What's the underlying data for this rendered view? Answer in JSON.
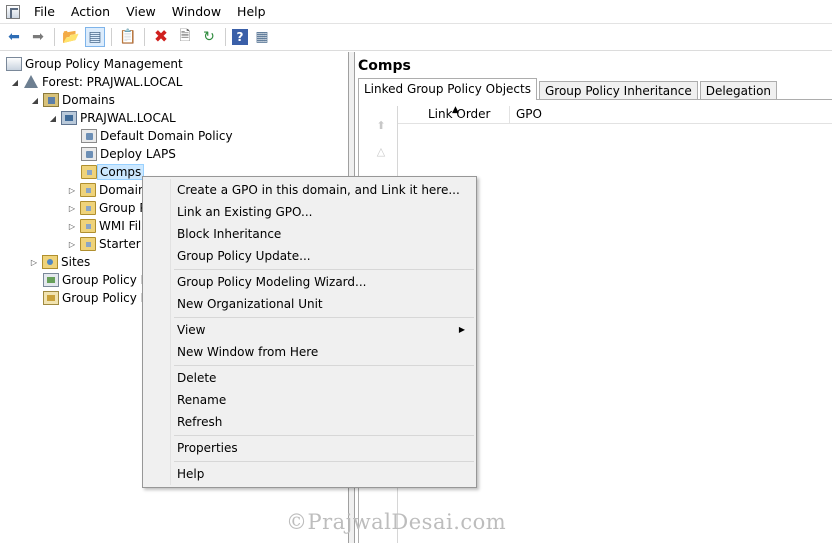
{
  "menubar": {
    "items": [
      {
        "label": "File"
      },
      {
        "label": "Action"
      },
      {
        "label": "View"
      },
      {
        "label": "Window"
      },
      {
        "label": "Help"
      }
    ]
  },
  "toolbar": {
    "buttons": [
      "back-arrow",
      "forward-arrow",
      "up-folder",
      "show-hide-tree",
      "properties",
      "delete",
      "export-list",
      "refresh",
      "help",
      "show-hide-action-pane"
    ]
  },
  "tree": {
    "root": "Group Policy Management",
    "forest": "Forest: PRAJWAL.LOCAL",
    "domains": "Domains",
    "domain": "PRAJWAL.LOCAL",
    "children": [
      {
        "label": "Default Domain Policy"
      },
      {
        "label": "Deploy LAPS"
      },
      {
        "label": "Comps"
      },
      {
        "label": "Domain"
      },
      {
        "label": "Group P"
      },
      {
        "label": "WMI Fil"
      },
      {
        "label": "Starter G"
      }
    ],
    "sites": "Sites",
    "modeling": "Group Policy M",
    "results": "Group Policy R"
  },
  "right": {
    "title": "Comps",
    "tabs": [
      {
        "label": "Linked Group Policy Objects"
      },
      {
        "label": "Group Policy Inheritance"
      },
      {
        "label": "Delegation"
      }
    ],
    "columns": {
      "link_order": "Link Order",
      "gpo": "GPO"
    }
  },
  "context_menu": {
    "items": [
      {
        "label": "Create a GPO in this domain, and Link it here..."
      },
      {
        "label": "Link an Existing GPO..."
      },
      {
        "label": "Block Inheritance"
      },
      {
        "label": "Group Policy Update..."
      },
      {
        "label": "Group Policy Modeling Wizard..."
      },
      {
        "label": "New Organizational Unit"
      },
      {
        "label": "View"
      },
      {
        "label": "New Window from Here"
      },
      {
        "label": "Delete"
      },
      {
        "label": "Rename"
      },
      {
        "label": "Refresh"
      },
      {
        "label": "Properties"
      },
      {
        "label": "Help"
      }
    ]
  },
  "watermark": "©PrajwalDesai.com",
  "colors": {
    "selection": "#cce8ff",
    "menu_bg": "#f0f0f0",
    "watermark": "#bdbdbd"
  }
}
